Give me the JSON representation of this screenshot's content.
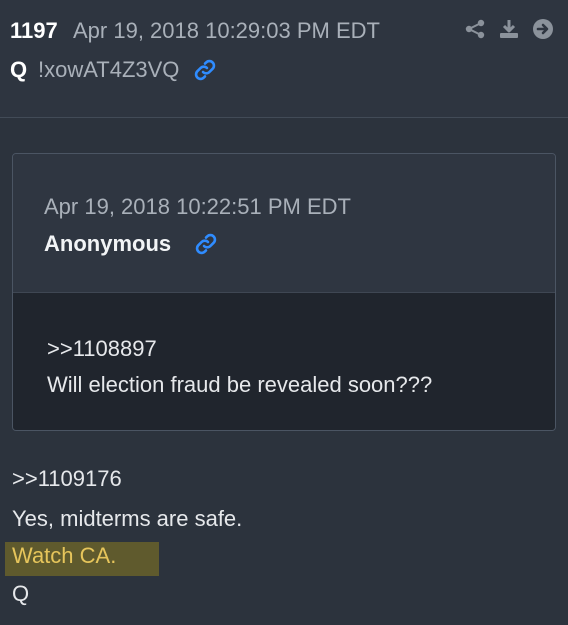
{
  "post": {
    "number": "1197",
    "timestamp": "Apr 19, 2018 10:29:03 PM EDT",
    "author": "Q",
    "tripcode": "!xowAT4Z3VQ",
    "link_icon": "link-icon",
    "toolbar_icons": [
      "share-icon",
      "download-icon",
      "forward-icon"
    ]
  },
  "quote": {
    "timestamp": "Apr 19, 2018 10:22:51 PM EDT",
    "author": "Anonymous",
    "link_icon": "link-icon",
    "reference": ">>1108897",
    "text": "Will election fraud be revealed soon???"
  },
  "body": {
    "reference": ">>1109176",
    "line1": "Yes, midterms are safe.",
    "line2_highlighted": "Watch CA.",
    "signature": "Q"
  },
  "colors": {
    "background": "#2c333d",
    "quote_body_bg": "#20252d",
    "highlight_bg": "#5f5a2d",
    "highlight_text": "#e6c55b",
    "link_blue": "#2f8cff"
  }
}
